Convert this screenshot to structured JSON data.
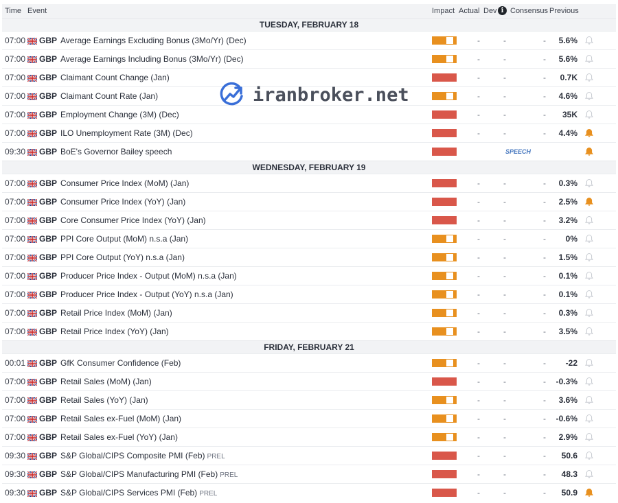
{
  "header": {
    "time": "Time",
    "event": "Event",
    "impact": "Impact",
    "actual": "Actual",
    "dev": "Dev",
    "info_icon": "i",
    "consensus": "Consensus",
    "previous": "Previous"
  },
  "watermark": {
    "text": "iranbroker.net",
    "icon": "chart-trend-icon"
  },
  "colors": {
    "high": "#d9574a",
    "medium": "#e8901f",
    "bell_active": "#e8901f",
    "bell_inactive": "#c8ccd2"
  },
  "days": [
    {
      "title": "TUESDAY, FEBRUARY 18",
      "rows": [
        {
          "time": "07:00",
          "currency": "GBP",
          "event": "Average Earnings Excluding Bonus (3Mo/Yr) (Dec)",
          "impact": "medium",
          "actual": "-",
          "dev": "-",
          "consensus": "-",
          "previous": "5.6%",
          "alert": false
        },
        {
          "time": "07:00",
          "currency": "GBP",
          "event": "Average Earnings Including Bonus (3Mo/Yr) (Dec)",
          "impact": "medium",
          "actual": "-",
          "dev": "-",
          "consensus": "-",
          "previous": "5.6%",
          "alert": false
        },
        {
          "time": "07:00",
          "currency": "GBP",
          "event": "Claimant Count Change (Jan)",
          "impact": "high",
          "actual": "-",
          "dev": "-",
          "consensus": "-",
          "previous": "0.7K",
          "alert": false
        },
        {
          "time": "07:00",
          "currency": "GBP",
          "event": "Claimant Count Rate (Jan)",
          "impact": "medium",
          "actual": "-",
          "dev": "-",
          "consensus": "-",
          "previous": "4.6%",
          "alert": false
        },
        {
          "time": "07:00",
          "currency": "GBP",
          "event": "Employment Change (3M) (Dec)",
          "impact": "high",
          "actual": "-",
          "dev": "-",
          "consensus": "-",
          "previous": "35K",
          "alert": false
        },
        {
          "time": "07:00",
          "currency": "GBP",
          "event": "ILO Unemployment Rate (3M) (Dec)",
          "impact": "high",
          "actual": "-",
          "dev": "-",
          "consensus": "-",
          "previous": "4.4%",
          "alert": true
        },
        {
          "time": "09:30",
          "currency": "GBP",
          "event": "BoE's Governor Bailey speech",
          "impact": "high",
          "speech": "SPEECH",
          "alert": true
        }
      ]
    },
    {
      "title": "WEDNESDAY, FEBRUARY 19",
      "rows": [
        {
          "time": "07:00",
          "currency": "GBP",
          "event": "Consumer Price Index (MoM) (Jan)",
          "impact": "high",
          "actual": "-",
          "dev": "-",
          "consensus": "-",
          "previous": "0.3%",
          "alert": false
        },
        {
          "time": "07:00",
          "currency": "GBP",
          "event": "Consumer Price Index (YoY) (Jan)",
          "impact": "high",
          "actual": "-",
          "dev": "-",
          "consensus": "-",
          "previous": "2.5%",
          "alert": true
        },
        {
          "time": "07:00",
          "currency": "GBP",
          "event": "Core Consumer Price Index (YoY) (Jan)",
          "impact": "high",
          "actual": "-",
          "dev": "-",
          "consensus": "-",
          "previous": "3.2%",
          "alert": false
        },
        {
          "time": "07:00",
          "currency": "GBP",
          "event": "PPI Core Output (MoM) n.s.a (Jan)",
          "impact": "medium",
          "actual": "-",
          "dev": "-",
          "consensus": "-",
          "previous": "0%",
          "alert": false
        },
        {
          "time": "07:00",
          "currency": "GBP",
          "event": "PPI Core Output (YoY) n.s.a (Jan)",
          "impact": "medium",
          "actual": "-",
          "dev": "-",
          "consensus": "-",
          "previous": "1.5%",
          "alert": false
        },
        {
          "time": "07:00",
          "currency": "GBP",
          "event": "Producer Price Index - Output (MoM) n.s.a (Jan)",
          "impact": "medium",
          "actual": "-",
          "dev": "-",
          "consensus": "-",
          "previous": "0.1%",
          "alert": false
        },
        {
          "time": "07:00",
          "currency": "GBP",
          "event": "Producer Price Index - Output (YoY) n.s.a (Jan)",
          "impact": "medium",
          "actual": "-",
          "dev": "-",
          "consensus": "-",
          "previous": "0.1%",
          "alert": false
        },
        {
          "time": "07:00",
          "currency": "GBP",
          "event": "Retail Price Index (MoM) (Jan)",
          "impact": "medium",
          "actual": "-",
          "dev": "-",
          "consensus": "-",
          "previous": "0.3%",
          "alert": false
        },
        {
          "time": "07:00",
          "currency": "GBP",
          "event": "Retail Price Index (YoY) (Jan)",
          "impact": "medium",
          "actual": "-",
          "dev": "-",
          "consensus": "-",
          "previous": "3.5%",
          "alert": false
        }
      ]
    },
    {
      "title": "FRIDAY, FEBRUARY 21",
      "rows": [
        {
          "time": "00:01",
          "currency": "GBP",
          "event": "GfK Consumer Confidence (Feb)",
          "impact": "medium",
          "actual": "-",
          "dev": "-",
          "consensus": "-",
          "previous": "-22",
          "alert": false
        },
        {
          "time": "07:00",
          "currency": "GBP",
          "event": "Retail Sales (MoM) (Jan)",
          "impact": "high",
          "actual": "-",
          "dev": "-",
          "consensus": "-",
          "previous": "-0.3%",
          "alert": false
        },
        {
          "time": "07:00",
          "currency": "GBP",
          "event": "Retail Sales (YoY) (Jan)",
          "impact": "medium",
          "actual": "-",
          "dev": "-",
          "consensus": "-",
          "previous": "3.6%",
          "alert": false
        },
        {
          "time": "07:00",
          "currency": "GBP",
          "event": "Retail Sales ex-Fuel (MoM) (Jan)",
          "impact": "medium",
          "actual": "-",
          "dev": "-",
          "consensus": "-",
          "previous": "-0.6%",
          "alert": false
        },
        {
          "time": "07:00",
          "currency": "GBP",
          "event": "Retail Sales ex-Fuel (YoY) (Jan)",
          "impact": "medium",
          "actual": "-",
          "dev": "-",
          "consensus": "-",
          "previous": "2.9%",
          "alert": false
        },
        {
          "time": "09:30",
          "currency": "GBP",
          "event": "S&P Global/CIPS Composite PMI (Feb)",
          "tag": "PREL",
          "impact": "high",
          "actual": "-",
          "dev": "-",
          "consensus": "-",
          "previous": "50.6",
          "alert": false
        },
        {
          "time": "09:30",
          "currency": "GBP",
          "event": "S&P Global/CIPS Manufacturing PMI (Feb)",
          "tag": "PREL",
          "impact": "high",
          "actual": "-",
          "dev": "-",
          "consensus": "-",
          "previous": "48.3",
          "alert": false
        },
        {
          "time": "09:30",
          "currency": "GBP",
          "event": "S&P Global/CIPS Services PMI (Feb)",
          "tag": "PREL",
          "impact": "high",
          "actual": "-",
          "dev": "-",
          "consensus": "-",
          "previous": "50.9",
          "alert": true
        }
      ]
    }
  ]
}
